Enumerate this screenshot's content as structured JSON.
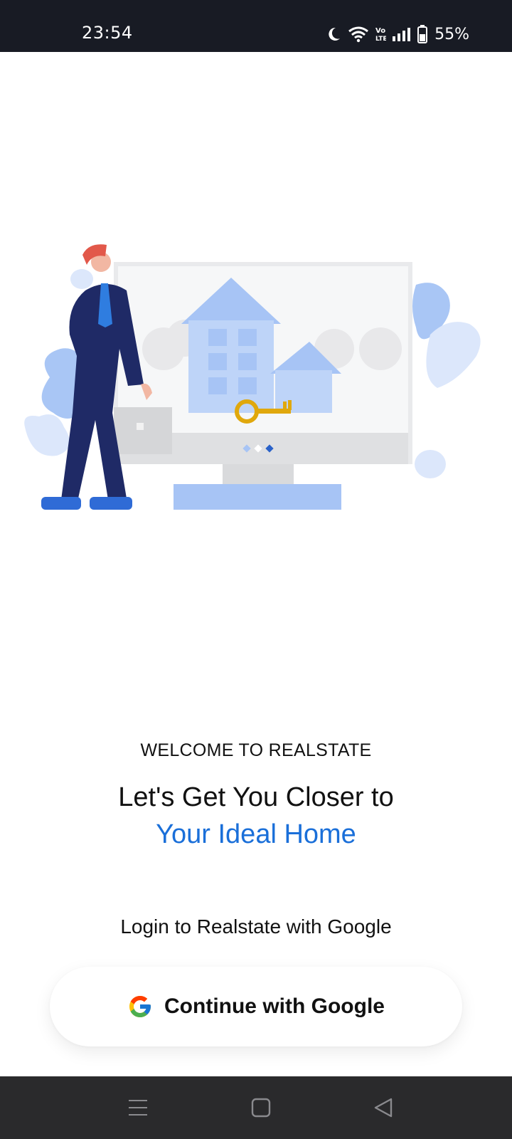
{
  "status_bar": {
    "time": "23:54",
    "battery": "55%",
    "icons": [
      "moon-icon",
      "wifi-icon",
      "volte-icon",
      "signal-icon",
      "battery-icon"
    ]
  },
  "illustration": {
    "description_icon": "realestate-illustration"
  },
  "content": {
    "welcome": "WELCOME TO REALSTATE",
    "headline_line1": "Let's Get You Closer to",
    "headline_line2": "Your Ideal Home",
    "login_prompt": "Login to Realstate with Google",
    "google_button_label": "Continue with Google"
  },
  "nav_bar": {
    "buttons": [
      "menu-icon",
      "home-icon",
      "back-icon"
    ]
  },
  "colors": {
    "accent": "#1a6fd9",
    "status_bar_bg": "#181b24",
    "nav_bar_bg": "#2a2a2c"
  }
}
